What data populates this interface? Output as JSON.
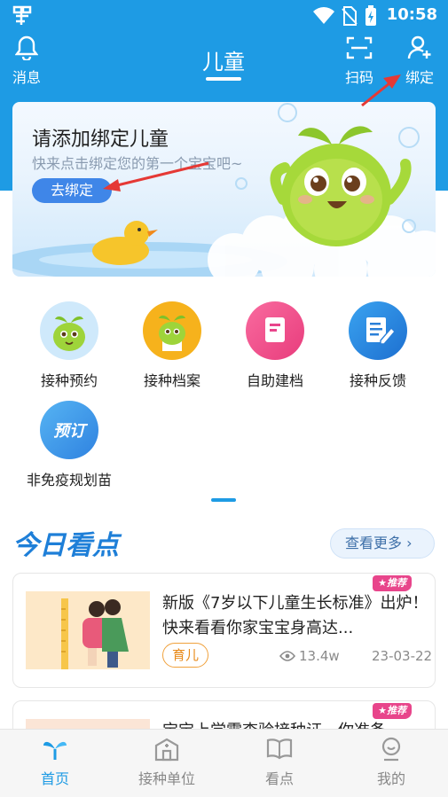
{
  "status_bar": {
    "time": "10:58"
  },
  "header": {
    "messages_label": "消息",
    "title": "儿童",
    "scan_label": "扫码",
    "bind_label": "绑定"
  },
  "banner": {
    "title": "请添加绑定儿童",
    "subtitle": "快来点击绑定您的第一个宝宝吧~",
    "button": "去绑定"
  },
  "services": [
    {
      "label": "接种预约",
      "icon": "sprout-mascot-icon"
    },
    {
      "label": "接种档案",
      "icon": "sprout-mascot-icon"
    },
    {
      "label": "自助建档",
      "icon": "notebook-icon"
    },
    {
      "label": "接种反馈",
      "icon": "edit-note-icon"
    },
    {
      "label": "非免疫规划苗",
      "icon": "reserve-icon",
      "icon_text": "预订"
    }
  ],
  "today": {
    "title": "今日看点",
    "more": "查看更多 ›"
  },
  "articles": [
    {
      "badge": "★推荐",
      "title": "新版《7岁以下儿童生长标准》出炉！快来看看你家宝宝身高达...",
      "category": "育儿",
      "views": "13.4w",
      "date": "23-03-22"
    },
    {
      "badge": "★推荐",
      "title": "宝宝上学需查验接种证，你准备"
    }
  ],
  "tabbar": {
    "items": [
      {
        "label": "首页",
        "active": true
      },
      {
        "label": "接种单位",
        "active": false
      },
      {
        "label": "看点",
        "active": false
      },
      {
        "label": "我的",
        "active": false
      }
    ]
  },
  "colors": {
    "primary": "#1e9be4",
    "accent_pink": "#e8458b",
    "tag_orange": "#e88a1a",
    "arrow_red": "#e53935"
  }
}
